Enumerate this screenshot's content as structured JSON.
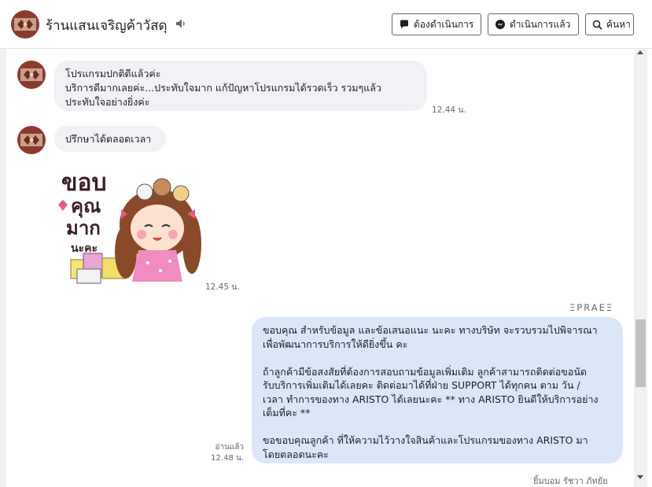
{
  "header": {
    "title": "ร้านแสนเจริญค้าวัสดุ",
    "buttons": {
      "todo": "ต้องดำเนินการ",
      "done": "ดำเนินการแล้ว",
      "search": "ค้นหา"
    }
  },
  "messages": {
    "m1": {
      "text": "โปรแกรมปกติดีแล้วค่ะ\nบริการดีมากเลยค่ะ...ประทับใจมาก แก้ปัญหาโปรแกรมได้รวดเร็ว รวมๆแล้ว\nประทับใจอย่างยิ่งค่ะ",
      "time": "12.44 น."
    },
    "m2": {
      "text": "ปรึกษาได้ตลอดเวลา"
    },
    "sticker": {
      "text_line1": "ขอบ",
      "text_line2": "คุณ",
      "text_line3": "มาก",
      "text_line4": "นะคะ",
      "time": "12.45 น."
    },
    "m3": {
      "sender": "ΞPRAEΞ",
      "text": "ขอบคุณ สำหรับข้อมูล และข้อเสนอแนะ นะคะ ทางบริษัท จะรวบรวมไปพิจารณา\nเพื่อพัฒนาการบริการให้ดียิ่งขึ้น คะ\n\nถ้าลูกค้ามีข้อสงสัยที่ต้องการสอบถามข้อมูลเพิ่มเติม ลูกค้าสามารถติดต่อขอนัด\nรับบริการเพิ่มเติมได้เลยคะ ติดต่อมาได้ที่ฝ่าย SUPPORT ได้ทุกคน ตาม วัน /\nเวลา ทำการของทาง ARISTO ได้เลยนะคะ ** ทาง ARISTO ยินดีให้บริการอย่าง\nเต็มที่คะ **\n\nขอขอบคุณลูกค้า ที่ให้ความไว้วางใจสินค้าและโปรแกรมของทาง ARISTO มา\nโดยตลอดนะคะ",
      "read": "อ่านแล้ว",
      "time": "12.48 น."
    },
    "next_partial": "ยิ้มบอม รัชวา ภัทยัย"
  },
  "colors": {
    "incoming_bubble": "#f0f2f5",
    "outgoing_bubble": "#dbe6f9",
    "avatar_bg": "#8b3a2f"
  },
  "icons": {
    "speaker": "speaker-icon",
    "todo": "speech-bubble-icon",
    "done": "messenger-icon",
    "search": "search-icon"
  }
}
